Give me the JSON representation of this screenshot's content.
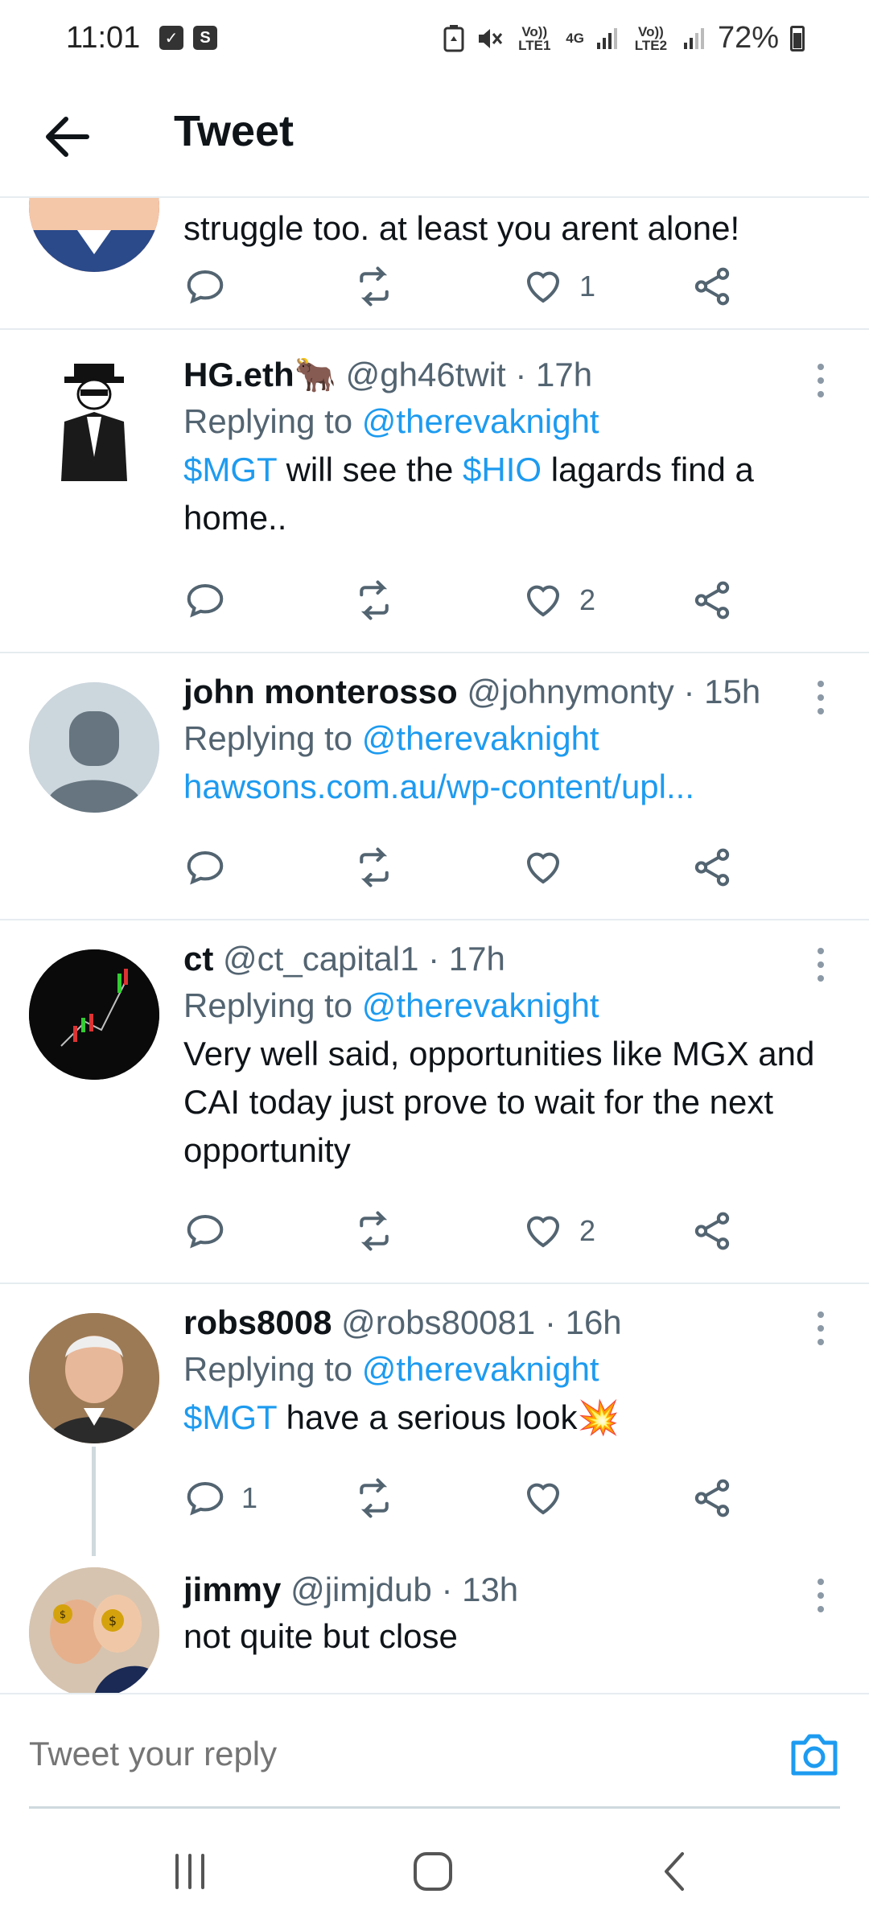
{
  "status_bar": {
    "time": "11:01",
    "net1": "Vo)) LTE1",
    "net_type": "4G",
    "net2": "Vo)) LTE2",
    "battery": "72%"
  },
  "header": {
    "title": "Tweet"
  },
  "tweets": [
    {
      "text": "struggle too. at least you arent alone!",
      "likes": "1"
    },
    {
      "name": "HG.eth",
      "handle": "@gh46twit",
      "time": "· 17h",
      "replying_prefix": "Replying to",
      "replying_to": "@therevaknight",
      "cashtag1": "$MGT",
      "text_a": " will see the ",
      "cashtag2": "$HIO",
      "text_b": " lagards find a home..",
      "likes": "2"
    },
    {
      "name": "john monterosso",
      "handle": "@johnymonty",
      "time": "· 15h",
      "replying_prefix": "Replying to",
      "replying_to": "@therevaknight",
      "link": "hawsons.com.au/wp-content/upl..."
    },
    {
      "name": "ct",
      "handle": "@ct_capital1",
      "time": "· 17h",
      "replying_prefix": "Replying to",
      "replying_to": "@therevaknight",
      "text": "Very well said, opportunities like MGX and CAI today just prove to wait for the next opportunity",
      "likes": "2"
    },
    {
      "name": "robs8008",
      "handle": "@robs80081",
      "time": "· 16h",
      "replying_prefix": "Replying to",
      "replying_to": "@therevaknight",
      "cashtag1": "$MGT",
      "text_a": " have a serious look💥",
      "replies": "1"
    },
    {
      "name": "jimmy",
      "handle": "@jimjdub",
      "time": "· 13h",
      "text": "not quite but close"
    }
  ],
  "reply_bar": {
    "placeholder": "Tweet your reply"
  },
  "icons": {
    "reply": "reply-icon",
    "retweet": "retweet-icon",
    "like": "heart-icon",
    "share": "share-icon",
    "more": "more-vertical-icon",
    "camera": "camera-icon"
  },
  "colors": {
    "accent": "#1d9bf0",
    "text": "#0f1419",
    "muted": "#536471"
  }
}
